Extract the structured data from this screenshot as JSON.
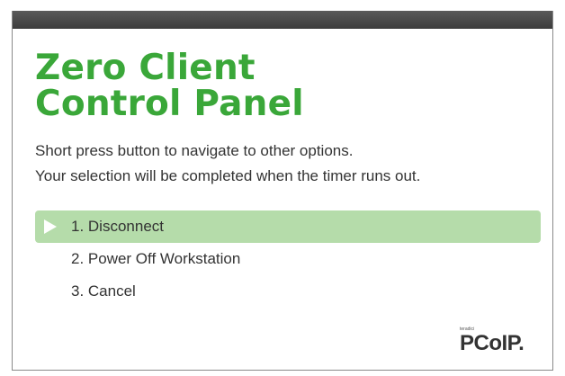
{
  "dialog": {
    "title_line1": "Zero Client",
    "title_line2": "Control Panel",
    "instruction_line1": "Short press button to navigate to other options.",
    "instruction_line2": "Your selection will be completed when the timer runs out."
  },
  "menu": {
    "items": [
      {
        "label": "1. Disconnect",
        "selected": true
      },
      {
        "label": "2. Power Off Workstation",
        "selected": false
      },
      {
        "label": "3. Cancel",
        "selected": false
      }
    ]
  },
  "logo": {
    "small_text": "teradici",
    "main_text": "PCoIP."
  },
  "colors": {
    "title_green": "#3aa739",
    "selected_bg": "#b5dcaa",
    "titlebar": "#4a4a4a"
  }
}
